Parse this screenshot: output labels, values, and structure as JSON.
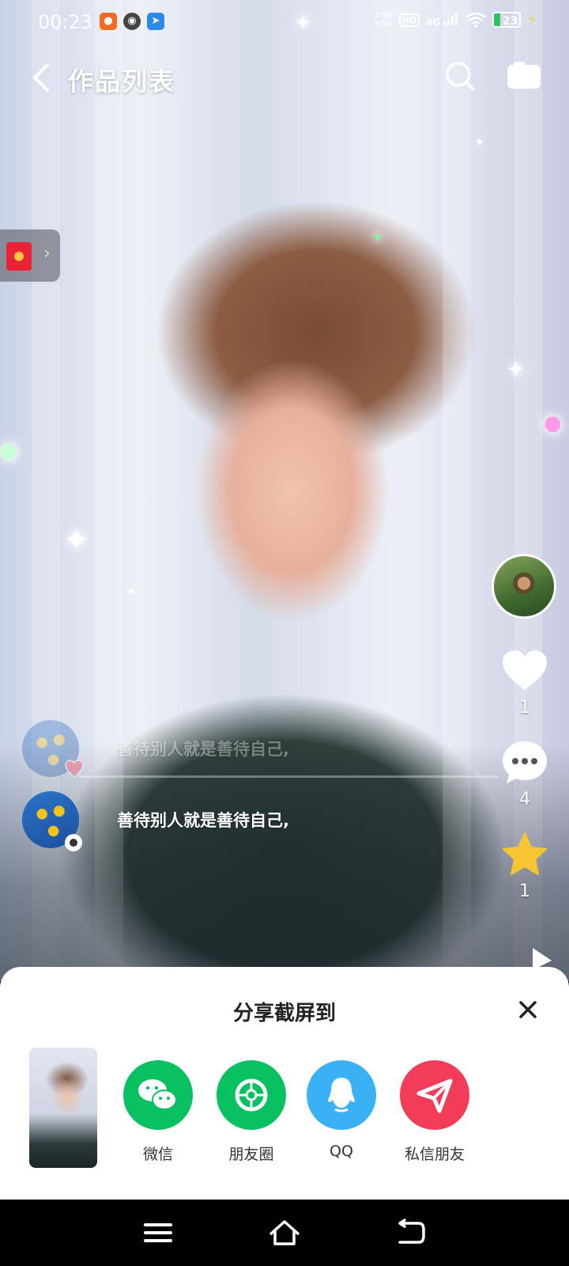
{
  "status_bar": {
    "time": "00:23",
    "net_speed_value": "5.90",
    "net_speed_unit": "KB/s",
    "hd_label": "HD",
    "network_label": "4G",
    "battery_level": "23",
    "battery_fraction": 0.23
  },
  "header": {
    "title": "作品列表"
  },
  "side_actions": {
    "like_count": "1",
    "comment_count": "4",
    "favorite_count": "1"
  },
  "comments": [
    {
      "text": "善待别人就是善待自己,"
    },
    {
      "text": "善待别人就是善待自己,"
    }
  ],
  "share_sheet": {
    "title": "分享截屏到",
    "targets": [
      {
        "label": "微信",
        "color": "#07c160"
      },
      {
        "label": "朋友圈",
        "color": "#07c160"
      },
      {
        "label": "QQ",
        "color": "#3ab0f5"
      },
      {
        "label": "私信朋友",
        "color": "#f23c5a"
      }
    ]
  },
  "colors": {
    "wechat_green": "#07c160",
    "qq_blue": "#3ab0f5",
    "dm_red": "#f23c5a",
    "favorite_yellow": "#f7c531",
    "battery_green": "#29c65b"
  },
  "icons": {
    "back": "chevron-left-icon",
    "search": "search-icon",
    "camera": "camera-icon",
    "like": "heart-icon",
    "comment": "comment-bubble-icon",
    "favorite": "star-icon",
    "close": "close-icon",
    "nav_menu": "menu-icon",
    "nav_home": "home-icon",
    "nav_back": "back-arrow-icon"
  }
}
